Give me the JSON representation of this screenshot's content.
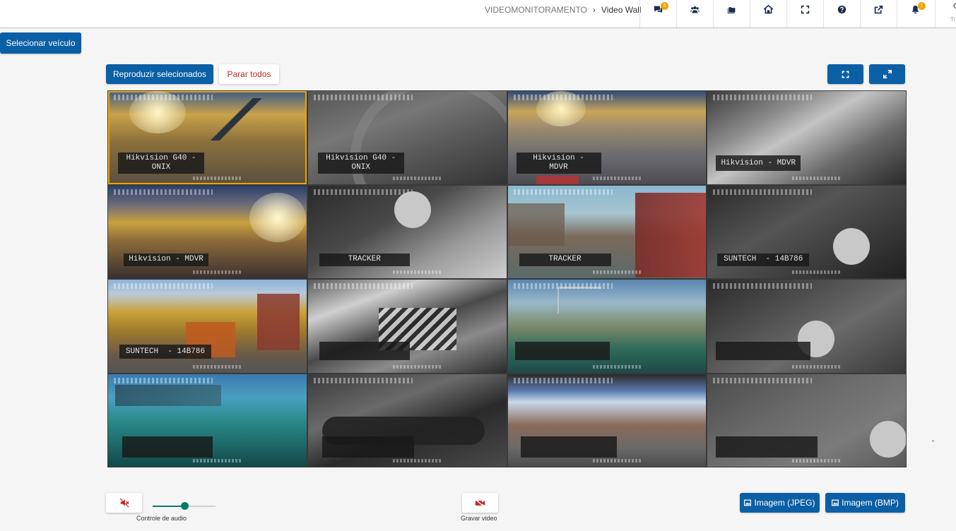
{
  "breadcrumb": {
    "section": "VIDEOMONITORAMENTO",
    "separator": "›",
    "current": "Video Wall"
  },
  "top_icons": [
    {
      "name": "chat-icon",
      "badge": "3"
    },
    {
      "name": "users-icon",
      "badge": ""
    },
    {
      "name": "folders-icon",
      "badge": ""
    },
    {
      "name": "home-icon",
      "badge": ""
    },
    {
      "name": "fullscreen-icon",
      "badge": ""
    },
    {
      "name": "help-icon",
      "badge": ""
    },
    {
      "name": "external-link-icon",
      "badge": ""
    },
    {
      "name": "notification-bell-icon",
      "badge": "1"
    }
  ],
  "user_edge": {
    "c1": "C",
    "c2": "Tr"
  },
  "select_vehicle_label": "Selecionar veículo",
  "toolbar": {
    "play_selected_label": "Reproduzir selecionados",
    "stop_all_label": "Parar todos"
  },
  "tiles": [
    {
      "label": "Hikvision G40 -\nONIX",
      "selected": true
    },
    {
      "label": "Hikvision G40 -\nONIX",
      "selected": false
    },
    {
      "label": "Hikvision -\nMDVR",
      "selected": false
    },
    {
      "label": "Hikvision - MDVR",
      "selected": false
    },
    {
      "label": "Hikvision - MDVR",
      "selected": false
    },
    {
      "label": "TRACKER",
      "selected": false
    },
    {
      "label": "TRACKER",
      "selected": false
    },
    {
      "label": "SUNTECH  - 14B786",
      "selected": false
    },
    {
      "label": "SUNTECH  - 14B786",
      "selected": false
    },
    {
      "label": "",
      "selected": false
    },
    {
      "label": "",
      "selected": false
    },
    {
      "label": "",
      "selected": false
    },
    {
      "label": "",
      "selected": false
    },
    {
      "label": "",
      "selected": false
    },
    {
      "label": "",
      "selected": false
    },
    {
      "label": "",
      "selected": false
    }
  ],
  "bottom": {
    "audio_caption": "Controle de audio",
    "audio_level": 0.5,
    "record_caption": "Gravar video",
    "jpeg_label": "Imagem (JPEG)",
    "bmp_label": "Imagem (BMP)"
  },
  "colors": {
    "primary": "#0b5fa5",
    "danger": "#c62828",
    "accent": "#0b7a6e",
    "badge": "#f0a500"
  }
}
